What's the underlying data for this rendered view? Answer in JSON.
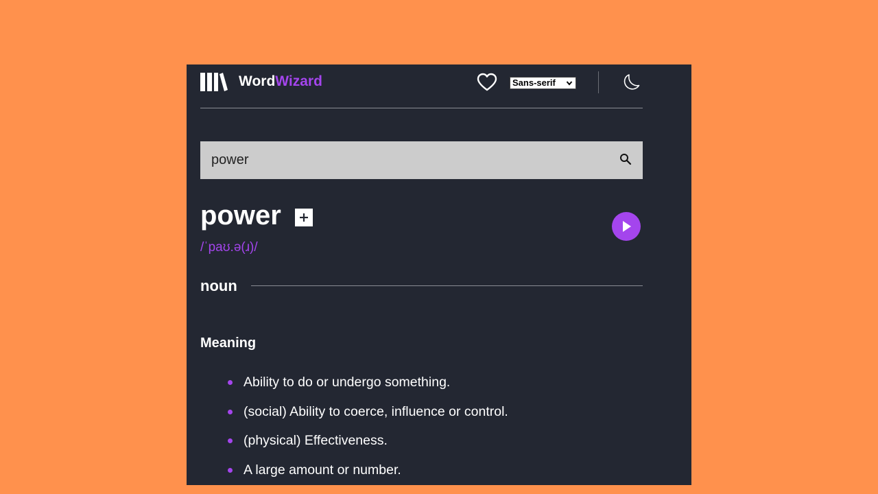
{
  "header": {
    "brand_part1": "Word",
    "brand_part2": "Wizard",
    "font_selected": "Sans-serif",
    "icons": [
      "library-logo-icon",
      "heart-icon",
      "chevron-down-icon",
      "moon-icon"
    ]
  },
  "search": {
    "value": "power",
    "icon": "search-icon"
  },
  "entry": {
    "word": "power",
    "phonetic": "/ˈpaʊ.ə(ɹ)/",
    "part_of_speech": "noun",
    "meaning_title": "Meaning",
    "definitions": [
      "Ability to do or undergo something.",
      "(social) Ability to coerce, influence or control.",
      "(physical) Effectiveness.",
      "A large amount or number."
    ]
  },
  "colors": {
    "background": "#FF914D",
    "panel": "#232732",
    "accent": "#A445ED",
    "search_bg": "#CCCCCC"
  }
}
